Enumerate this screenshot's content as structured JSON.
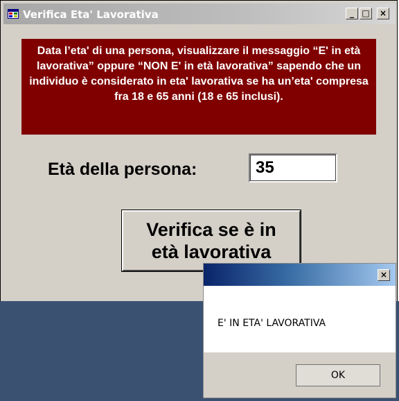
{
  "window": {
    "title": "Verifica Eta' Lavorativa",
    "buttons": {
      "minimize": "_",
      "maximize": "□",
      "close": "×"
    }
  },
  "description": "Data l’eta' di una persona, visualizzare il messaggio “E' in età lavorativa” oppure “NON E' in età lavorativa” sapendo che un individuo è considerato in eta' lavorativa se ha un’eta' compresa fra 18 e 65 anni (18 e 65 inclusi).",
  "form": {
    "age_label": "Età della persona:",
    "age_value": "35",
    "verify_button_line1": "Verifica se è in",
    "verify_button_line2": "età lavorativa"
  },
  "message_box": {
    "close": "×",
    "message": "E' IN ETA' LAVORATIVA",
    "ok_label": "OK"
  },
  "colors": {
    "description_bg": "#800000",
    "window_bg": "#d4d0c8",
    "desktop": "#3a5172"
  }
}
